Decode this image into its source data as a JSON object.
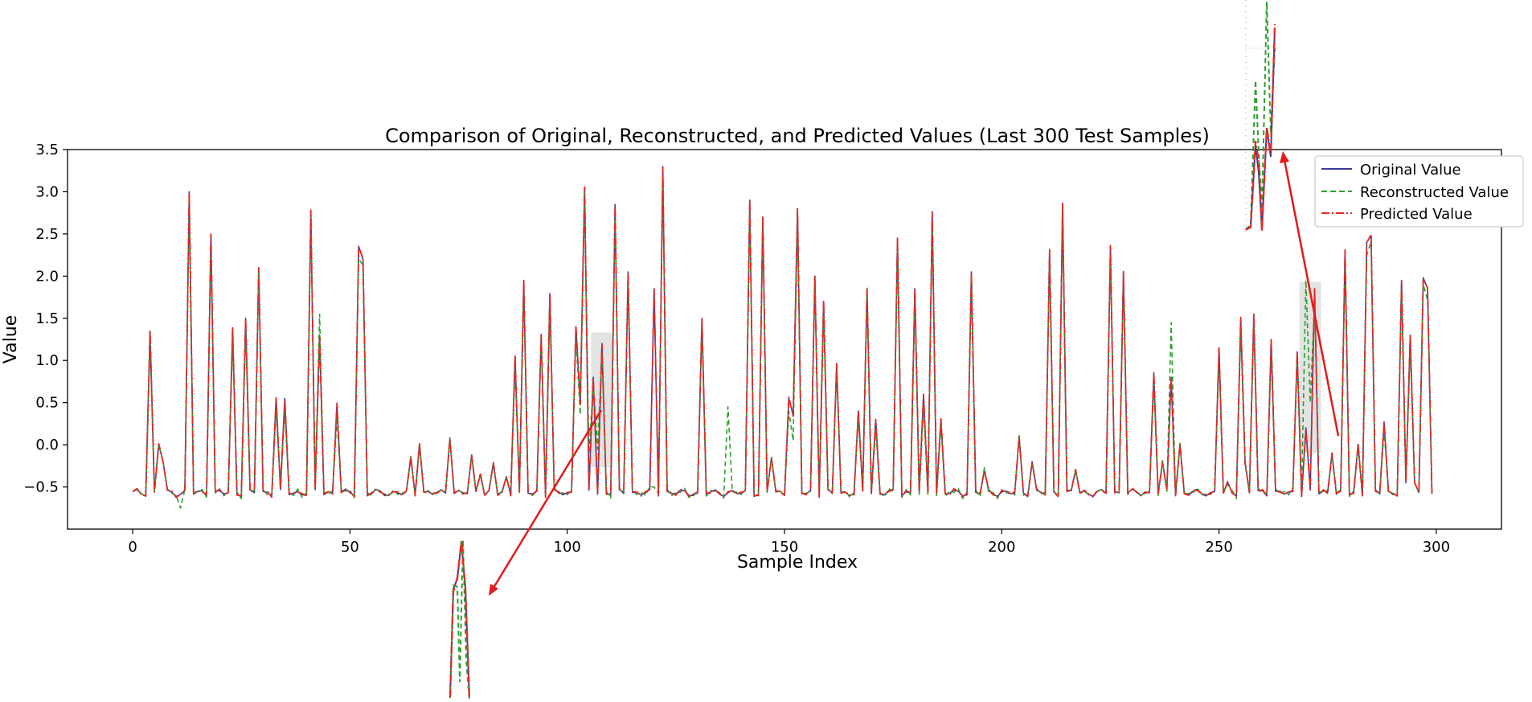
{
  "chart_data": {
    "type": "line",
    "title": "Comparison of Original, Reconstructed, and Predicted Values (Last 300 Test Samples)",
    "xlabel": "Sample Index",
    "ylabel": "Value",
    "xlim": [
      -15,
      315
    ],
    "ylim": [
      -1.0,
      3.5
    ],
    "x_ticks": [
      0,
      50,
      100,
      150,
      200,
      250,
      300
    ],
    "y_ticks": [
      -0.5,
      0.0,
      0.5,
      1.0,
      1.5,
      2.0,
      2.5,
      3.0,
      3.5
    ],
    "x_tick_labels": [
      "0",
      "50",
      "100",
      "150",
      "200",
      "250",
      "300"
    ],
    "y_tick_labels": [
      "−0.5",
      "0.0",
      "0.5",
      "1.0",
      "1.5",
      "2.0",
      "2.5",
      "3.0",
      "3.5"
    ],
    "legend_position": "top-right",
    "grid": false,
    "series": [
      {
        "name": "Original Value",
        "color": "#3b3b9a",
        "style": "solid"
      },
      {
        "name": "Reconstructed Value",
        "color": "#2ca02c",
        "style": "dashed"
      },
      {
        "name": "Predicted Value",
        "color": "#e8281e",
        "style": "dashdot"
      }
    ],
    "peaks": [
      [
        4,
        1.35
      ],
      [
        6,
        0.0
      ],
      [
        7,
        -0.2
      ],
      [
        13,
        3.0
      ],
      [
        18,
        2.5
      ],
      [
        23,
        1.38
      ],
      [
        26,
        1.5
      ],
      [
        29,
        2.1
      ],
      [
        33,
        0.55
      ],
      [
        35,
        0.55
      ],
      [
        41,
        2.78
      ],
      [
        43,
        1.3
      ],
      [
        47,
        0.48
      ],
      [
        52,
        2.35
      ],
      [
        53,
        2.2
      ],
      [
        64,
        -0.15
      ],
      [
        66,
        0.0
      ],
      [
        73,
        0.08
      ],
      [
        78,
        -0.12
      ],
      [
        80,
        -0.35
      ],
      [
        83,
        -0.22
      ],
      [
        86,
        -0.38
      ],
      [
        88,
        1.05
      ],
      [
        90,
        1.95
      ],
      [
        94,
        1.3
      ],
      [
        96,
        1.78
      ],
      [
        102,
        1.4
      ],
      [
        103,
        0.5
      ],
      [
        104,
        3.05
      ],
      [
        106,
        0.8
      ],
      [
        108,
        1.2
      ],
      [
        111,
        2.85
      ],
      [
        114,
        2.05
      ],
      [
        120,
        1.85
      ],
      [
        122,
        3.3
      ],
      [
        131,
        1.5
      ],
      [
        142,
        2.9
      ],
      [
        145,
        2.7
      ],
      [
        147,
        -0.15
      ],
      [
        151,
        0.55
      ],
      [
        152,
        0.35
      ],
      [
        153,
        2.8
      ],
      [
        157,
        2.0
      ],
      [
        159,
        1.7
      ],
      [
        162,
        0.95
      ],
      [
        167,
        0.4
      ],
      [
        169,
        1.85
      ],
      [
        171,
        0.3
      ],
      [
        176,
        2.45
      ],
      [
        180,
        1.85
      ],
      [
        182,
        0.6
      ],
      [
        184,
        2.75
      ],
      [
        186,
        0.3
      ],
      [
        193,
        2.05
      ],
      [
        196,
        -0.3
      ],
      [
        204,
        0.1
      ],
      [
        207,
        -0.2
      ],
      [
        211,
        2.3
      ],
      [
        214,
        2.85
      ],
      [
        217,
        -0.3
      ],
      [
        225,
        2.35
      ],
      [
        228,
        2.05
      ],
      [
        235,
        0.85
      ],
      [
        237,
        -0.2
      ],
      [
        239,
        0.8
      ],
      [
        241,
        0.0
      ],
      [
        250,
        1.15
      ],
      [
        252,
        -0.45
      ],
      [
        255,
        1.5
      ],
      [
        256,
        -0.2
      ],
      [
        258,
        1.55
      ],
      [
        262,
        1.25
      ],
      [
        268,
        1.1
      ],
      [
        270,
        0.2
      ],
      [
        272,
        1.85
      ],
      [
        276,
        -0.1
      ],
      [
        279,
        2.3
      ],
      [
        282,
        0.0
      ],
      [
        284,
        2.4
      ],
      [
        285,
        2.48
      ],
      [
        288,
        0.27
      ],
      [
        292,
        1.95
      ],
      [
        293,
        -0.45
      ],
      [
        294,
        1.3
      ],
      [
        295,
        -0.45
      ],
      [
        297,
        1.98
      ],
      [
        298,
        1.85
      ]
    ],
    "reconstructed_deviations": [
      [
        11,
        -0.75
      ],
      [
        43,
        1.55
      ],
      [
        94,
        1.32
      ],
      [
        105,
        -0.1
      ],
      [
        107,
        -0.05
      ],
      [
        120,
        -0.5
      ],
      [
        137,
        0.45
      ],
      [
        152,
        0.05
      ],
      [
        169,
        1.88
      ],
      [
        239,
        1.45
      ],
      [
        270,
        1.95
      ],
      [
        271,
        0.5
      ]
    ],
    "highlight_regions": [
      [
        105.5,
        110.5,
        -0.27,
        1.33
      ],
      [
        268.5,
        273.5,
        -0.1,
        1.93
      ]
    ]
  }
}
